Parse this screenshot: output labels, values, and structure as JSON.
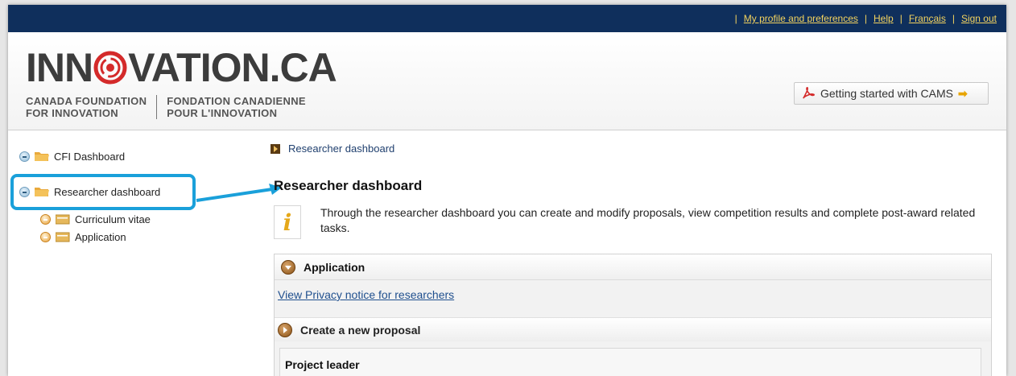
{
  "top_nav": {
    "links": [
      "My profile and preferences",
      "Help",
      "Français",
      "Sign out"
    ],
    "separator": "|"
  },
  "header": {
    "logo_part1": "INN",
    "logo_part2": "VATION.CA",
    "logo_sub_en_line1": "CANADA FOUNDATION",
    "logo_sub_en_line2": "FOR INNOVATION",
    "logo_sub_fr_line1": "FONDATION CANADIENNE",
    "logo_sub_fr_line2": "POUR L'INNOVATION",
    "cams_button": "Getting started with CAMS"
  },
  "sidebar": {
    "items": [
      {
        "label": "CFI Dashboard"
      },
      {
        "label": "Researcher dashboard"
      },
      {
        "label": "Curriculum vitae"
      },
      {
        "label": "Application"
      }
    ]
  },
  "main": {
    "breadcrumb": "Researcher dashboard",
    "title": "Researcher dashboard",
    "info_text": "Through the researcher dashboard you can create and modify proposals, view competition results and complete post-award related tasks.",
    "panel_title": "Application",
    "privacy_link": "View Privacy notice for researchers",
    "sub_title": "Create a new proposal",
    "leader_label": "Project leader"
  },
  "colors": {
    "topbar": "#0f2f5c",
    "link_gold": "#f4d35e",
    "highlight": "#1aa0da",
    "logo_red": "#d42a2a"
  }
}
